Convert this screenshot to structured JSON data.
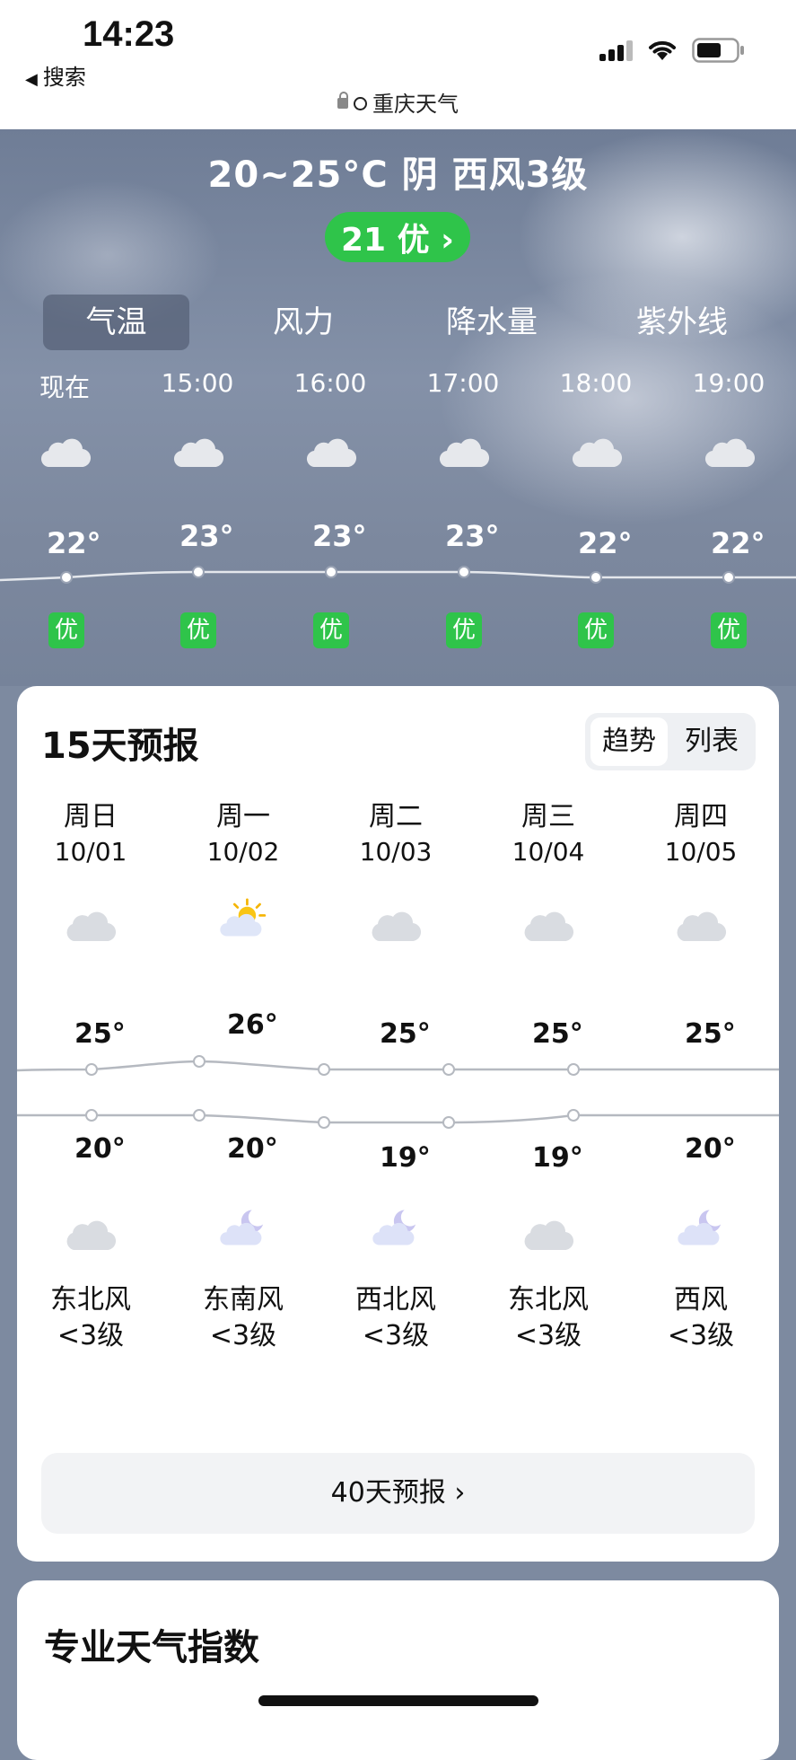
{
  "status": {
    "time": "14:23",
    "back_label": "搜索"
  },
  "url": {
    "text": "重庆天气"
  },
  "current": {
    "summary": "20~25°C 阴 西风3级",
    "aqi_label": "21 优 ›"
  },
  "tabs": [
    "气温",
    "风力",
    "降水量",
    "紫外线"
  ],
  "hourly": [
    {
      "time": "现在",
      "temp": "22°",
      "aqi": "优",
      "icon": "cloudy-icon"
    },
    {
      "time": "15:00",
      "temp": "23°",
      "aqi": "优",
      "icon": "cloudy-icon"
    },
    {
      "time": "16:00",
      "temp": "23°",
      "aqi": "优",
      "icon": "cloudy-icon"
    },
    {
      "time": "17:00",
      "temp": "23°",
      "aqi": "优",
      "icon": "cloudy-icon"
    },
    {
      "time": "18:00",
      "temp": "22°",
      "aqi": "优",
      "icon": "cloudy-icon"
    },
    {
      "time": "19:00",
      "temp": "22°",
      "aqi": "优",
      "icon": "cloudy-icon"
    }
  ],
  "forecast15": {
    "title": "15天预报",
    "toggle": [
      "趋势",
      "列表"
    ],
    "days": [
      {
        "weekday": "周日",
        "date": "10/01",
        "high": "25°",
        "low": "20°",
        "day_icon": "cloudy-icon",
        "night_icon": "cloudy-icon",
        "wind": "东北风",
        "wind_level": "<3级"
      },
      {
        "weekday": "周一",
        "date": "10/02",
        "high": "26°",
        "low": "20°",
        "day_icon": "sun-cloud-icon",
        "night_icon": "moon-cloud-icon",
        "wind": "东南风",
        "wind_level": "<3级"
      },
      {
        "weekday": "周二",
        "date": "10/03",
        "high": "25°",
        "low": "19°",
        "day_icon": "cloudy-icon",
        "night_icon": "moon-cloud-icon",
        "wind": "西北风",
        "wind_level": "<3级"
      },
      {
        "weekday": "周三",
        "date": "10/04",
        "high": "25°",
        "low": "19°",
        "day_icon": "cloudy-icon",
        "night_icon": "cloudy-icon",
        "wind": "东北风",
        "wind_level": "<3级"
      },
      {
        "weekday": "周四",
        "date": "10/05",
        "high": "25°",
        "low": "20°",
        "day_icon": "cloudy-icon",
        "night_icon": "moon-cloud-icon",
        "wind": "西风",
        "wind_level": "<3级"
      }
    ],
    "more_label": "40天预报 ›"
  },
  "indices": {
    "title": "专业天气指数"
  },
  "colors": {
    "aqi_green": "#2fc44a",
    "sky": "#7d8aa0",
    "card": "#ffffff",
    "line": "#b5b9c0"
  }
}
